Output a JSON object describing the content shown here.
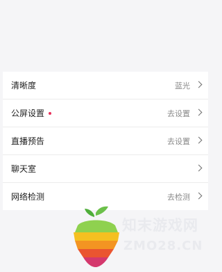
{
  "settings": {
    "items": [
      {
        "label": "清晰度",
        "value": "蓝光",
        "has_dot": false
      },
      {
        "label": "公屏设置",
        "value": "去设置",
        "has_dot": true
      },
      {
        "label": "直播预告",
        "value": "去设置",
        "has_dot": false
      },
      {
        "label": "聊天室",
        "value": "",
        "has_dot": false
      },
      {
        "label": "网络检测",
        "value": "去检测",
        "has_dot": false
      }
    ]
  },
  "watermark": {
    "title": "知末游戏网",
    "url": "ZMO28.CN"
  },
  "colors": {
    "background": "#f5f5f7",
    "row_background": "#ffffff",
    "notification_dot": "#e8305a",
    "secondary_text": "#8a8a8a"
  }
}
